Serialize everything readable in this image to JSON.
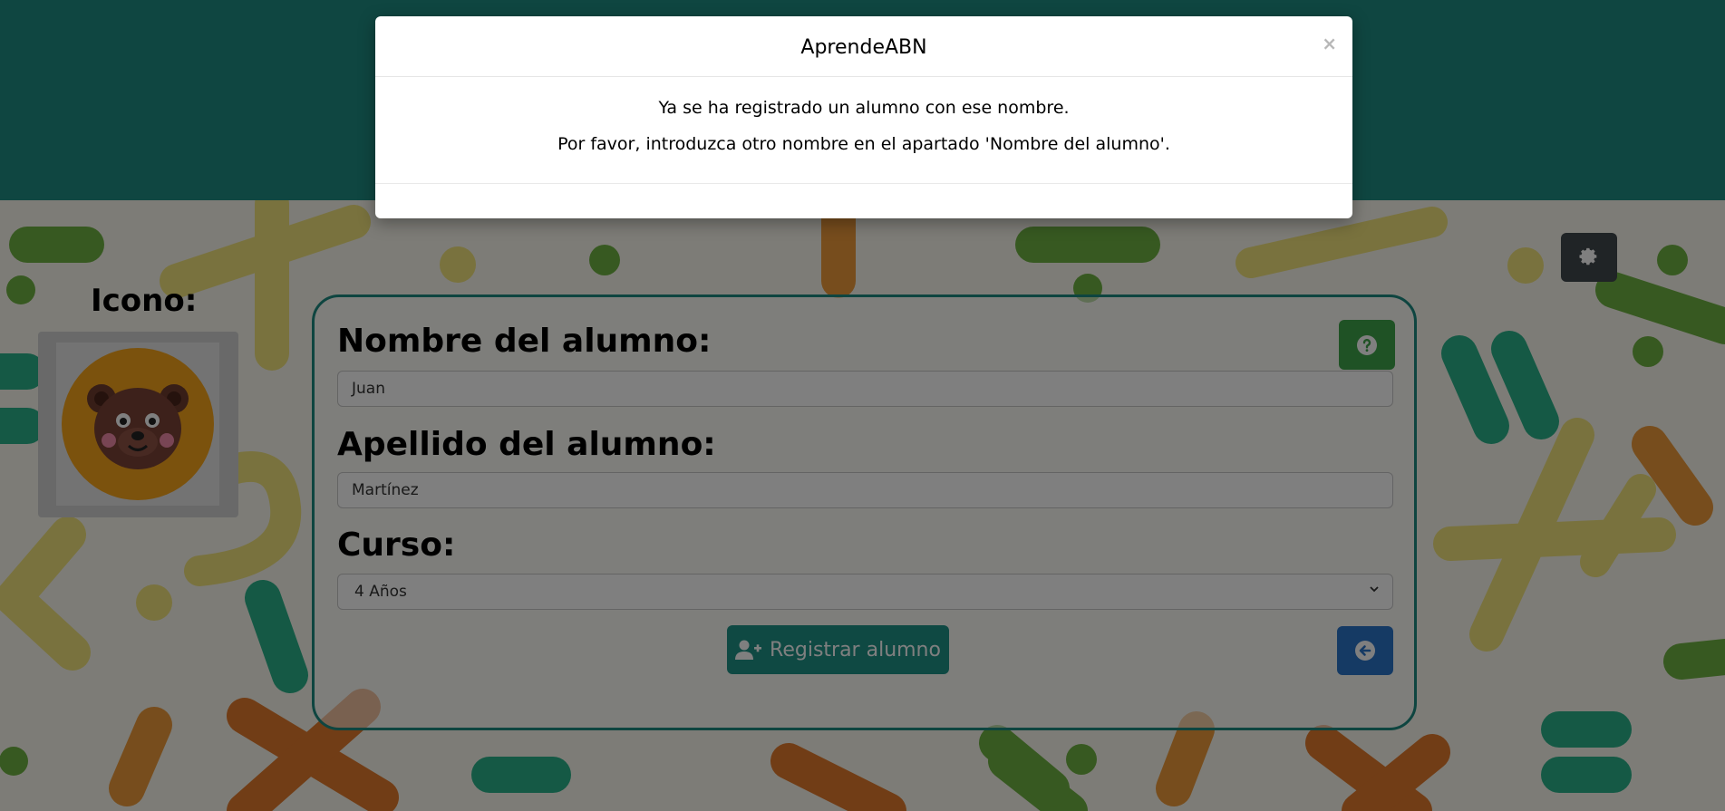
{
  "colors": {
    "header": "#1f8c82",
    "card_border": "#1d8a80",
    "help_button": "#3fa44a",
    "register_button": "#1f9287",
    "back_button": "#2a74c9",
    "settings_button": "#41484d"
  },
  "modal": {
    "title": "AprendeABN",
    "close_label": "×",
    "message_line1": "Ya se ha registrado un alumno con ese nombre.",
    "message_line2": "Por favor, introduzca otro nombre en el apartado 'Nombre del alumno'."
  },
  "settings_button": {
    "icon": "gear-icon"
  },
  "icon_section": {
    "label": "Icono:",
    "avatar": "bear-avatar"
  },
  "form": {
    "first_name": {
      "label": "Nombre del alumno:",
      "value": "Juan"
    },
    "last_name": {
      "label": "Apellido del alumno:",
      "value": "Martínez"
    },
    "course": {
      "label": "Curso:",
      "selected": "4 Años"
    },
    "help_button": {
      "icon": "question-circle-icon"
    },
    "register_button": {
      "label": "Registrar alumno",
      "icon": "user-plus-icon"
    },
    "back_button": {
      "icon": "arrow-left-circle-icon"
    }
  }
}
